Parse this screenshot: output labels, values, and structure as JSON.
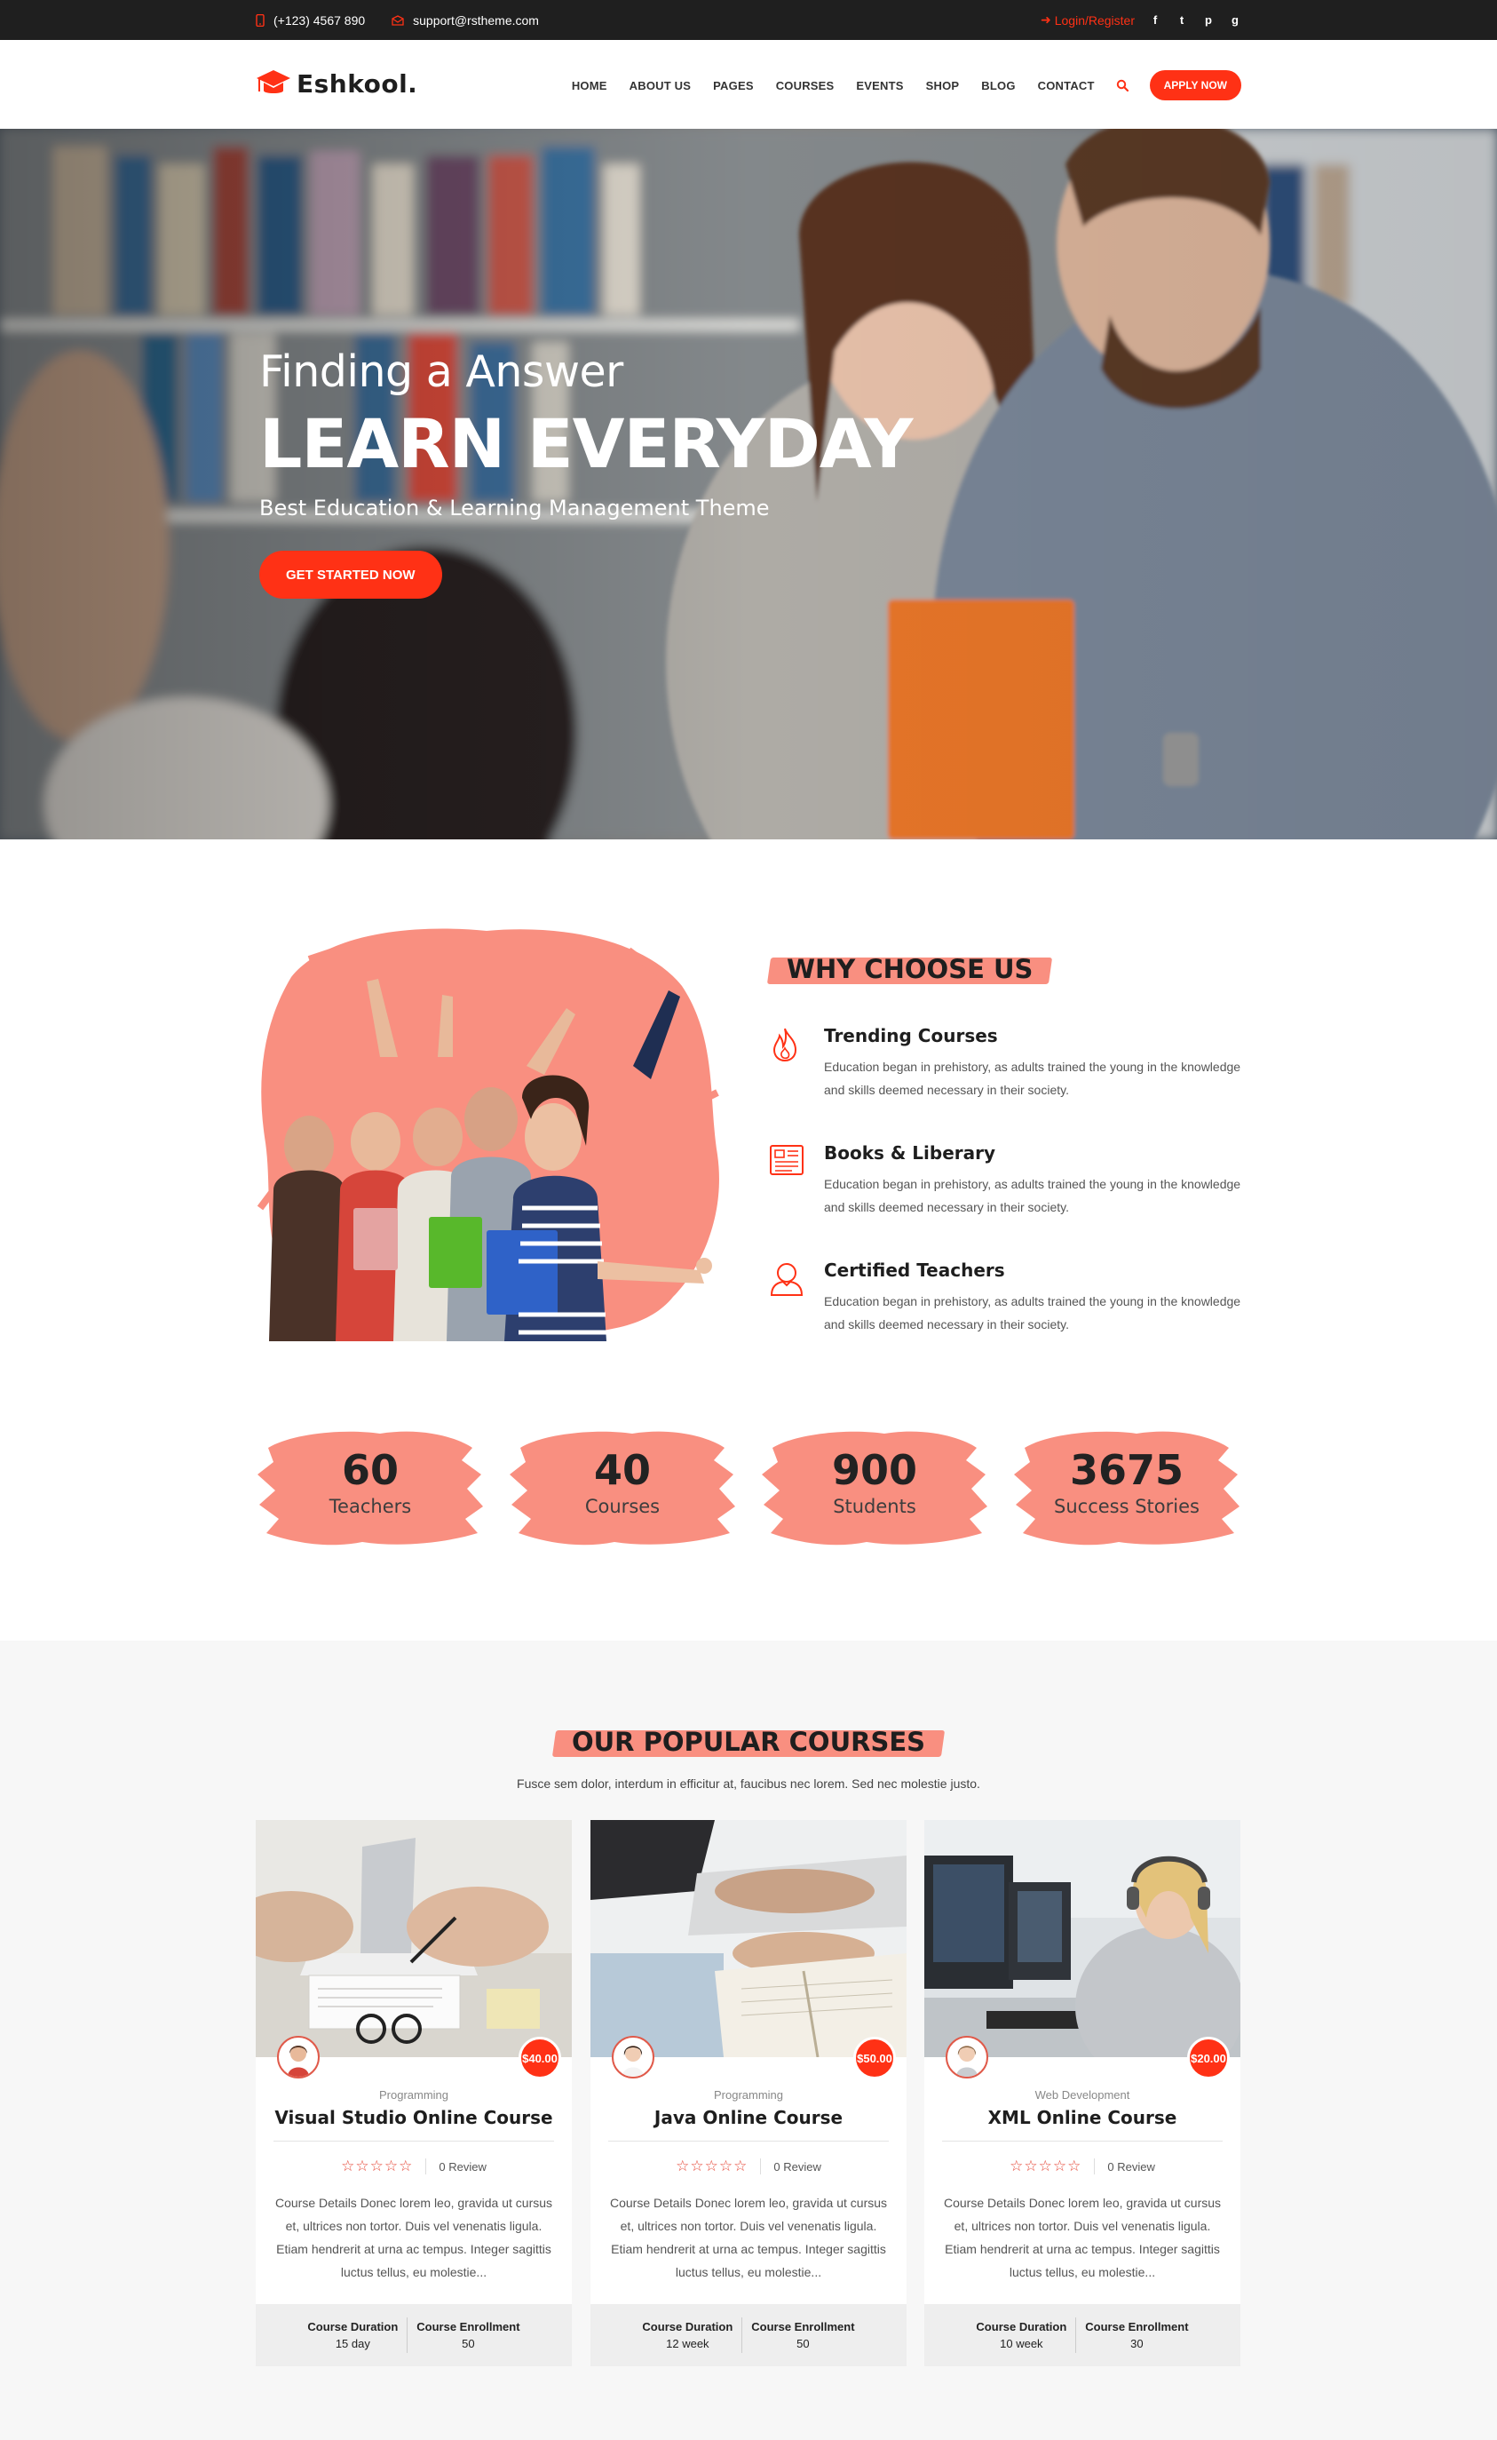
{
  "topbar": {
    "phone": "(+123) 4567 890",
    "email": "support@rstheme.com",
    "login": "Login/Register",
    "social": [
      "f",
      "t",
      "p",
      "g"
    ]
  },
  "header": {
    "brand": "Eshkool.",
    "nav": [
      "HOME",
      "ABOUT US",
      "PAGES",
      "COURSES",
      "EVENTS",
      "SHOP",
      "BLOG",
      "CONTACT"
    ],
    "apply": "APPLY NOW"
  },
  "hero": {
    "subtitle": "Finding a Answer",
    "title": "LEARN EVERYDAY",
    "description": "Best Education & Learning Management Theme",
    "cta": "GET STARTED NOW"
  },
  "why": {
    "heading": "WHY CHOOSE US",
    "features": [
      {
        "title": "Trending Courses",
        "text": "Education began in prehistory, as adults trained the young in the knowledge and skills deemed necessary in their society.",
        "icon": "flame-icon"
      },
      {
        "title": "Books & Liberary",
        "text": "Education began in prehistory, as adults trained the young in the knowledge and skills deemed necessary in their society.",
        "icon": "book-icon"
      },
      {
        "title": "Certified Teachers",
        "text": "Education began in prehistory, as adults trained the young in the knowledge and skills deemed necessary in their society.",
        "icon": "teacher-icon"
      }
    ]
  },
  "counters": [
    {
      "num": "60",
      "label": "Teachers"
    },
    {
      "num": "40",
      "label": "Courses"
    },
    {
      "num": "900",
      "label": "Students"
    },
    {
      "num": "3675",
      "label": "Success Stories"
    }
  ],
  "courses": {
    "heading": "OUR POPULAR COURSES",
    "intro": "Fusce sem dolor, interdum in efficitur at, faucibus nec lorem. Sed nec molestie justo.",
    "duration_label": "Course Duration",
    "enrollment_label": "Course Enrollment",
    "items": [
      {
        "category": "Programming",
        "title": "Visual Studio Online Course",
        "price": "$40.00",
        "review": "0 Review",
        "desc": "Course Details Donec lorem leo, gravida ut cursus et, ultrices non tortor. Duis vel venenatis ligula. Etiam hendrerit at urna ac tempus. Integer sagittis luctus tellus, eu molestie...",
        "duration": "15 day",
        "enrollment": "50"
      },
      {
        "category": "Programming",
        "title": "Java Online Course",
        "price": "$50.00",
        "review": "0 Review",
        "desc": "Course Details Donec lorem leo, gravida ut cursus et, ultrices non tortor. Duis vel venenatis ligula. Etiam hendrerit at urna ac tempus. Integer sagittis luctus tellus, eu molestie...",
        "duration": "12 week",
        "enrollment": "50"
      },
      {
        "category": "Web Development",
        "title": "XML Online Course",
        "price": "$20.00",
        "review": "0 Review",
        "desc": "Course Details Donec lorem leo, gravida ut cursus et, ultrices non tortor. Duis vel venenatis ligula. Etiam hendrerit at urna ac tempus. Integer sagittis luctus tellus, eu molestie...",
        "duration": "10 week",
        "enrollment": "30"
      }
    ]
  },
  "colors": {
    "accent": "#ff3115",
    "brush": "#f98f80",
    "dark": "#1f1f1f"
  }
}
